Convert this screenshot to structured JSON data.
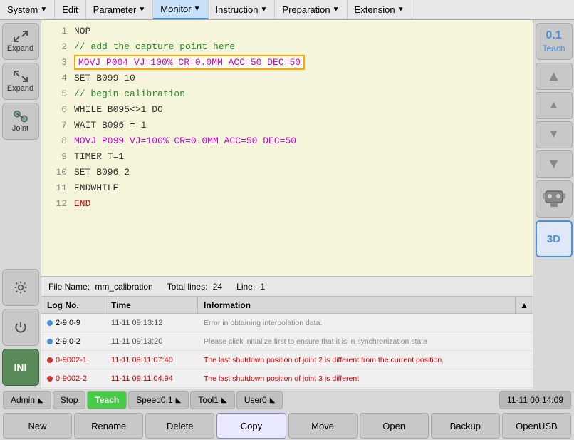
{
  "menu": {
    "items": [
      {
        "label": "System",
        "hasArrow": true,
        "active": false
      },
      {
        "label": "Edit",
        "hasArrow": false,
        "active": false
      },
      {
        "label": "Parameter",
        "hasArrow": true,
        "active": false
      },
      {
        "label": "Monitor",
        "hasArrow": true,
        "active": true
      },
      {
        "label": "Instruction",
        "hasArrow": true,
        "active": false
      },
      {
        "label": "Preparation",
        "hasArrow": true,
        "active": false
      },
      {
        "label": "Extension",
        "hasArrow": true,
        "active": false
      }
    ]
  },
  "sidebar_left": {
    "expand1_label": "Expand",
    "expand2_label": "Expand",
    "joint_label": "Joint",
    "ini_label": "INI"
  },
  "right_panel": {
    "value": "0.1",
    "label": "Teach"
  },
  "code": {
    "lines": [
      {
        "num": 1,
        "text": "NOP",
        "style": "normal"
      },
      {
        "num": 2,
        "text": "// add the capture point here",
        "style": "green"
      },
      {
        "num": 3,
        "text": "MOVJ P004 VJ=100% CR=0.0MM ACC=50 DEC=50",
        "style": "magenta",
        "selected": true
      },
      {
        "num": 4,
        "text": "SET B099 10",
        "style": "normal"
      },
      {
        "num": 5,
        "text": "// begin calibration",
        "style": "green"
      },
      {
        "num": 6,
        "text": "WHILE B095<>1 DO",
        "style": "normal"
      },
      {
        "num": 7,
        "text": "WAIT B096 = 1",
        "style": "normal"
      },
      {
        "num": 8,
        "text": "MOVJ P099 VJ=100% CR=0.0MM ACC=50 DEC=50",
        "style": "magenta"
      },
      {
        "num": 9,
        "text": "TIMER T=1",
        "style": "normal"
      },
      {
        "num": 10,
        "text": "SET B096 2",
        "style": "normal"
      },
      {
        "num": 11,
        "text": "ENDWHILE",
        "style": "normal"
      },
      {
        "num": 12,
        "text": "END",
        "style": "red"
      }
    ]
  },
  "status_bar": {
    "filename_label": "File Name:",
    "filename": "mm_calibration",
    "total_lines_label": "Total lines:",
    "total_lines": "24",
    "line_label": "Line:",
    "line": "1"
  },
  "log": {
    "columns": [
      "Log No.",
      "Time",
      "Information"
    ],
    "rows": [
      {
        "logno": "2-9:0-9",
        "time": "11-11 09:13:12",
        "info": "Error in obtaining interpolation data.",
        "dot_color": "blue",
        "highlighted": false
      },
      {
        "logno": "2-9:0-2",
        "time": "11-11 09:13:20",
        "info": "Please click initialize first to ensure that it is in synchronization state",
        "dot_color": "blue",
        "highlighted": false
      },
      {
        "logno": "0-9002-1",
        "time": "11-11 09:11:07:40",
        "info": "The last shutdown position of joint 2 is different from the current position.",
        "dot_color": "red",
        "highlighted": true
      },
      {
        "logno": "0-9002-2",
        "time": "11-11 09:11:04:94",
        "info": "The last shutdown position of joint 3 is different",
        "dot_color": "red",
        "highlighted": true
      }
    ]
  },
  "bottom_status": {
    "admin": "Admin",
    "stop": "Stop",
    "teach": "Teach",
    "speed": "Speed0.1",
    "tool": "Tool1",
    "user": "User0",
    "datetime": "11-11 00:14:09"
  },
  "bottom_actions": {
    "new": "New",
    "rename": "Rename",
    "delete": "Delete",
    "copy": "Copy",
    "move": "Move",
    "open": "Open",
    "backup": "Backup",
    "openusb": "OpenUSB"
  }
}
